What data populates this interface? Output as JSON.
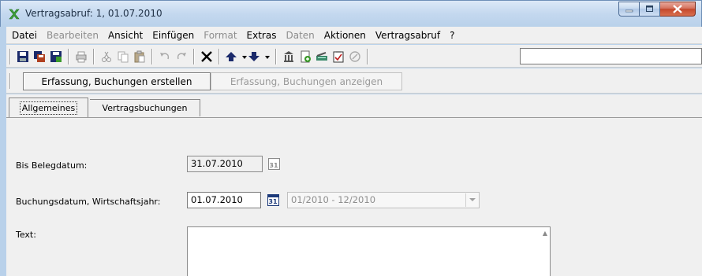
{
  "window": {
    "title": "Vertragsabruf: 1, 01.07.2010",
    "app_icon": "green-x-icon",
    "controls": [
      "minimize",
      "maximize",
      "close"
    ]
  },
  "menu": [
    {
      "label": "Datei",
      "disabled": false
    },
    {
      "label": "Bearbeiten",
      "disabled": true
    },
    {
      "label": "Ansicht",
      "disabled": false
    },
    {
      "label": "Einfügen",
      "disabled": false
    },
    {
      "label": "Format",
      "disabled": true
    },
    {
      "label": "Extras",
      "disabled": false
    },
    {
      "label": "Daten",
      "disabled": true
    },
    {
      "label": "Aktionen",
      "disabled": false
    },
    {
      "label": "Vertragsabruf",
      "disabled": false
    },
    {
      "label": "?",
      "disabled": false
    }
  ],
  "toolbar": {
    "icons": [
      "save-icon",
      "save-copy-icon",
      "save-close-icon",
      "print-icon",
      "cut-icon",
      "copy-icon",
      "paste-icon",
      "undo-icon",
      "redo-icon",
      "delete-icon",
      "arrow-up-icon",
      "arrow-down-icon",
      "archive-icon",
      "new-doc-icon",
      "scanner-icon",
      "checklist-icon",
      "settings-icon"
    ],
    "field_value": ""
  },
  "commands": {
    "create_label": "Erfassung, Buchungen erstellen",
    "show_label": "Erfassung, Buchungen anzeigen"
  },
  "tabs": [
    {
      "label": "Allgemeines",
      "active": true
    },
    {
      "label": "Vertragsbuchungen",
      "active": false
    }
  ],
  "form": {
    "bis_belegdatum_label": "Bis Belegdatum:",
    "bis_belegdatum_value": "31.07.2010",
    "buchungsdatum_label": "Buchungsdatum, Wirtschaftsjahr:",
    "buchungsdatum_value": "01.07.2010",
    "wirtschaftsjahr_value": "01/2010 - 12/2010",
    "text_label": "Text:",
    "text_value": "",
    "calendar_glyph": "31"
  },
  "colors": {
    "title_bg": "#c4d8ef",
    "close_button": "#c4472c",
    "calendar_active": "#1d3a7a"
  }
}
